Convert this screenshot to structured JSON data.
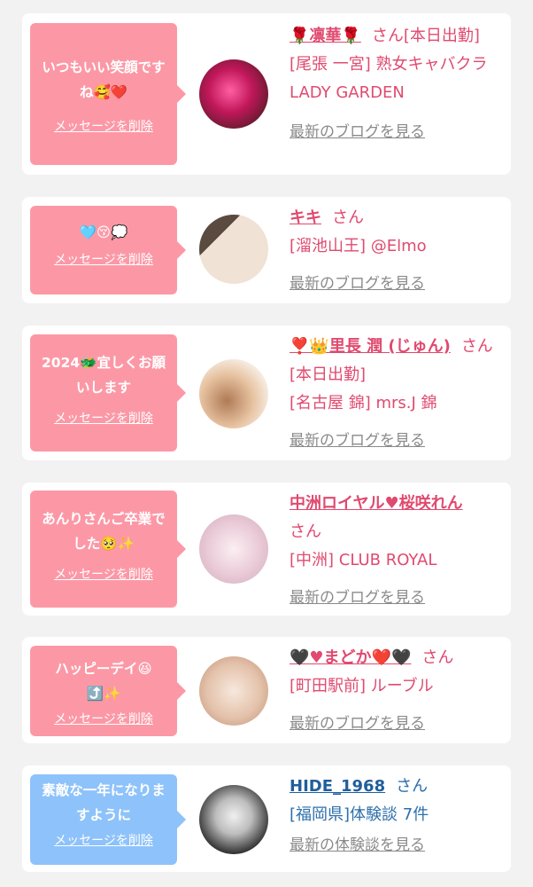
{
  "items": [
    {
      "message": "いつもいい笑顔ですね🥰❤️",
      "delete_label": "メッセージを削除",
      "name": "🌹凛華🌹",
      "honorific": "さん",
      "tag": "[本日出勤]",
      "shop": "[尾張 一宮] 熟女キャバクラ LADY GARDEN",
      "blog_label": "最新のブログを見る",
      "avatar_colors": [
        "#c2185b",
        "#5d1a2a"
      ]
    },
    {
      "message": "🩵😚💭",
      "delete_label": "メッセージを削除",
      "name": "キキ",
      "honorific": "さん",
      "tag": "",
      "shop": "[溜池山王] @Elmo",
      "blog_label": "最新のブログを見る",
      "avatar_colors": [
        "#e8d6c6",
        "#8b6f5a"
      ]
    },
    {
      "message": "2024🐲宜しくお願いします",
      "delete_label": "メッセージを削除",
      "name": "❣️👑里長 潤 (じゅん)",
      "honorific": "さん",
      "tag": "[本日出勤]",
      "shop": "[名古屋 錦] mrs.J 錦",
      "blog_label": "最新のブログを見る",
      "avatar_colors": [
        "#f4e3d3",
        "#b07a55"
      ]
    },
    {
      "message": "あんりさんご卒業でした🥺✨",
      "delete_label": "メッセージを削除",
      "name": "中洲ロイヤル♥桜咲れん",
      "honorific": "さん",
      "tag": "",
      "shop": "[中洲] CLUB ROYAL",
      "blog_label": "最新のブログを見る",
      "avatar_colors": [
        "#f7e1ea",
        "#d9b8c6"
      ]
    },
    {
      "message": "ハッピーデイ😆⤴️✨",
      "delete_label": "メッセージを削除",
      "name": "🖤♥まどか❤️🖤",
      "honorific": "さん",
      "tag": "",
      "shop": "[町田駅前] ルーブル",
      "blog_label": "最新のブログを見る",
      "avatar_colors": [
        "#f4e2d5",
        "#c79a7f"
      ]
    },
    {
      "message": "素敵な一年になりますように",
      "delete_label": "メッセージを削除",
      "name": "HIDE_1968",
      "honorific": "さん",
      "tag": "",
      "shop": "[福岡県]体験談 7件",
      "blog_label": "最新の体験談を見る",
      "avatar_colors": [
        "#e6e6e6",
        "#2b2b2b"
      ]
    }
  ],
  "colors": {
    "pink_bubble": "#fc98a6",
    "blue_bubble": "#8ec2fa",
    "pink_text": "#e04a6f",
    "blue_text": "#2d6fab",
    "link_gray": "#8a8a8a"
  }
}
